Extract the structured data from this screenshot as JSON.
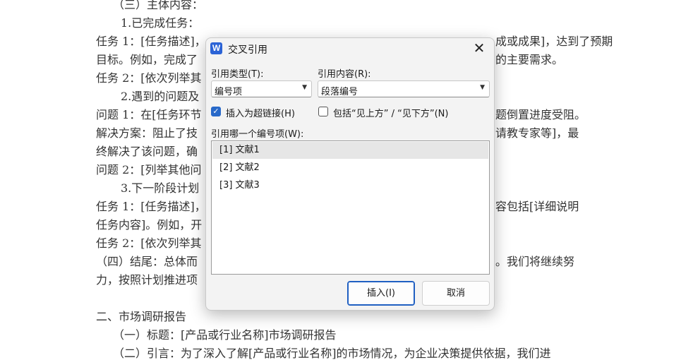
{
  "document": {
    "lines": [
      "（三）主体内容：",
      "1.已完成任务：",
      "任务 1：[任务描述]，",
      "的主要需求。",
      "目标。例如，完成了",
      "任务 2：[依次列举其",
      "2.遇到的问题及",
      "问题 1：在[任务环节",
      "题倒置进度受阻。",
      "解决方案：阻止了技",
      "请教专家等]，最",
      "终解决了该问题，确",
      "问题 2：[列举其他问",
      "3.下一阶段计划",
      "任务 1：[任务描述]，",
      "容包括[详细说明",
      "任务内容]。例如，开",
      "任务 2：[依次列举其",
      "（四）结尾：总体而",
      "。我们将继续努",
      "力，按照计划推进项",
      "二、市场调研报告",
      "（一）标题：[产品或行业名称]市场调研报告",
      "（二）引言：为了深入了解[产品或行业名称]的市场情况，为企业决策提供依据，我们进",
      "成或成果]，达到了预期"
    ]
  },
  "dialog": {
    "app_icon": "W",
    "title": "交叉引用",
    "close_glyph": "✕",
    "ref_type_label": "引用类型(T):",
    "ref_type_value": "编号项",
    "ref_content_label": "引用内容(R):",
    "ref_content_value": "段落编号",
    "hyperlink_label": "插入为超链接(H)",
    "hyperlink_checked": true,
    "above_below_label": "包括“见上方” / “见下方”(N)",
    "above_below_checked": false,
    "which_label": "引用哪一个编号项(W):",
    "items": [
      "[1] 文献1",
      "[2] 文献2",
      "[3] 文献3"
    ],
    "selected_index": 0,
    "insert_button": "插入(I)",
    "cancel_button": "取消"
  }
}
